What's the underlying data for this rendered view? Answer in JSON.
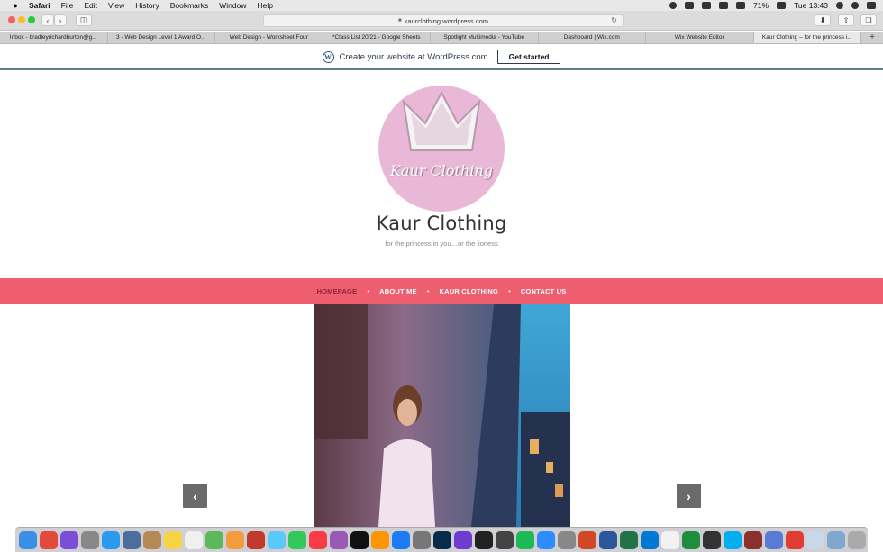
{
  "menubar": {
    "app": "Safari",
    "items": [
      "File",
      "Edit",
      "View",
      "History",
      "Bookmarks",
      "Window",
      "Help"
    ],
    "battery": "71%",
    "clock": "Tue 13:43"
  },
  "browser": {
    "url": "kaurclothing.wordpress.com",
    "tabs": [
      "Inbox - bradleyrichardburton@g...",
      "3 - Web Design Level 1 Award O...",
      "Web Design - Worksheet Four",
      "*Class List 20/21 - Google Sheets",
      "Spotlight Multimedia - YouTube",
      "Dashboard | Wix.com",
      "Wix Website Editor",
      "Kaur Clothing – for the princess i..."
    ]
  },
  "wp_banner": {
    "text": "Create your website at WordPress.com",
    "cta": "Get started"
  },
  "site": {
    "logo_text": "Kaur Clothing",
    "title": "Kaur Clothing",
    "tagline": "for the princess in you…or the lioness"
  },
  "nav": {
    "items": [
      "HOMEPAGE",
      "ABOUT ME",
      "KAUR CLOTHING",
      "CONTACT US"
    ]
  },
  "colors": {
    "nav_bg": "#ee5e6f",
    "logo_bg": "#e9b8d6",
    "nav_current": "#8e2736"
  },
  "slider": {
    "prev_icon": "chevron-left-icon",
    "next_icon": "chevron-right-icon"
  },
  "dock": {
    "icons": [
      "finder-icon",
      "chrome-icon",
      "siri-icon",
      "launchpad-icon",
      "safari-icon",
      "preview-icon",
      "contacts-icon",
      "notes-icon",
      "reminders-icon",
      "maps-icon",
      "photos-icon",
      "photo-booth-icon",
      "messages-icon",
      "facetime-icon",
      "music-icon",
      "podcasts-icon",
      "tv-icon",
      "books-icon",
      "app-store-icon",
      "system-preferences-icon",
      "photoshop-icon",
      "imovie-icon",
      "stocks-icon",
      "quicktime-icon",
      "spotify-icon",
      "zoom-icon",
      "screenshot-icon",
      "powerpoint-icon",
      "word-icon",
      "excel-icon",
      "outlook-icon",
      "calendar-icon",
      "classroom-icon",
      "screen-recorder-icon",
      "skype-icon",
      "dictionary-icon",
      "preview-icon-2",
      "creative-cloud-icon",
      "documents-icon",
      "mail-folder-icon",
      "trash-icon"
    ]
  }
}
